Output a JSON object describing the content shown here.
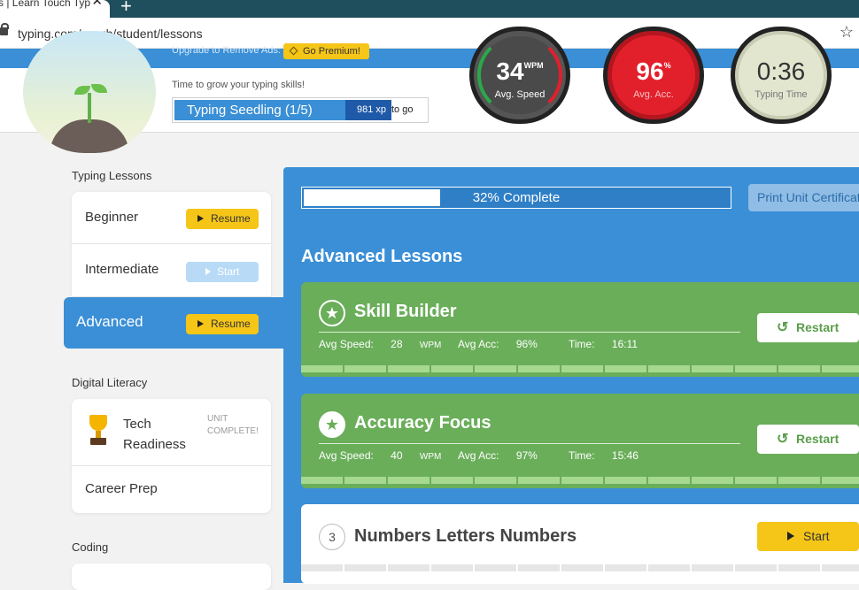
{
  "browser": {
    "tab_title": "s | Learn Touch Typ",
    "url": "typing.com/en-gb/student/lessons"
  },
  "header": {
    "upgrade_text": "Upgrade to Remove Ads:",
    "premium_label": "Go Premium!",
    "grow_text": "Time to grow your typing skills!",
    "rank_label": "Typing Seedling (1/5)",
    "xp_label": "981 xp",
    "xp_suffix": "to go",
    "stats": {
      "speed_value": "34",
      "speed_unit": "WPM",
      "speed_label": "Avg. Speed",
      "accuracy_value": "96",
      "accuracy_unit": "%",
      "accuracy_label": "Avg. Acc.",
      "time_value": "0:36",
      "time_label": "Typing Time"
    }
  },
  "sidebar": {
    "typing_lessons_title": "Typing Lessons",
    "typing_lessons": [
      {
        "label": "Beginner",
        "action": "Resume"
      },
      {
        "label": "Intermediate",
        "action": "Start"
      },
      {
        "label": "Advanced",
        "action": "Resume"
      }
    ],
    "digital_literacy_title": "Digital Literacy",
    "digital_literacy": [
      {
        "label_line1": "Tech",
        "label_line2": "Readiness",
        "status_line1": "UNIT",
        "status_line2": "COMPLETE!"
      },
      {
        "label": "Career Prep"
      }
    ],
    "coding_title": "Coding"
  },
  "main": {
    "unit_progress_percent": 32,
    "unit_progress_text": "32% Complete",
    "print_button": "Print Unit Certificate",
    "section_title": "Advanced Lessons",
    "lessons": [
      {
        "name": "Skill Builder",
        "speed_label": "Avg Speed:",
        "speed_value": "28",
        "speed_unit": "WPM",
        "acc_label": "Avg Acc:",
        "acc_value": "96%",
        "time_label": "Time:",
        "time_value": "16:11",
        "action": "Restart"
      },
      {
        "name": "Accuracy Focus",
        "speed_label": "Avg Speed:",
        "speed_value": "40",
        "speed_unit": "WPM",
        "acc_label": "Avg Acc:",
        "acc_value": "97%",
        "time_label": "Time:",
        "time_value": "15:46",
        "action": "Restart"
      },
      {
        "number": "3",
        "name": "Numbers Letters Numbers",
        "action": "Start"
      }
    ]
  },
  "colors": {
    "brand_blue": "#3a8fd6",
    "complete_green": "#6aae5a",
    "action_yellow": "#f5c518",
    "accuracy_red": "#e2202b"
  }
}
